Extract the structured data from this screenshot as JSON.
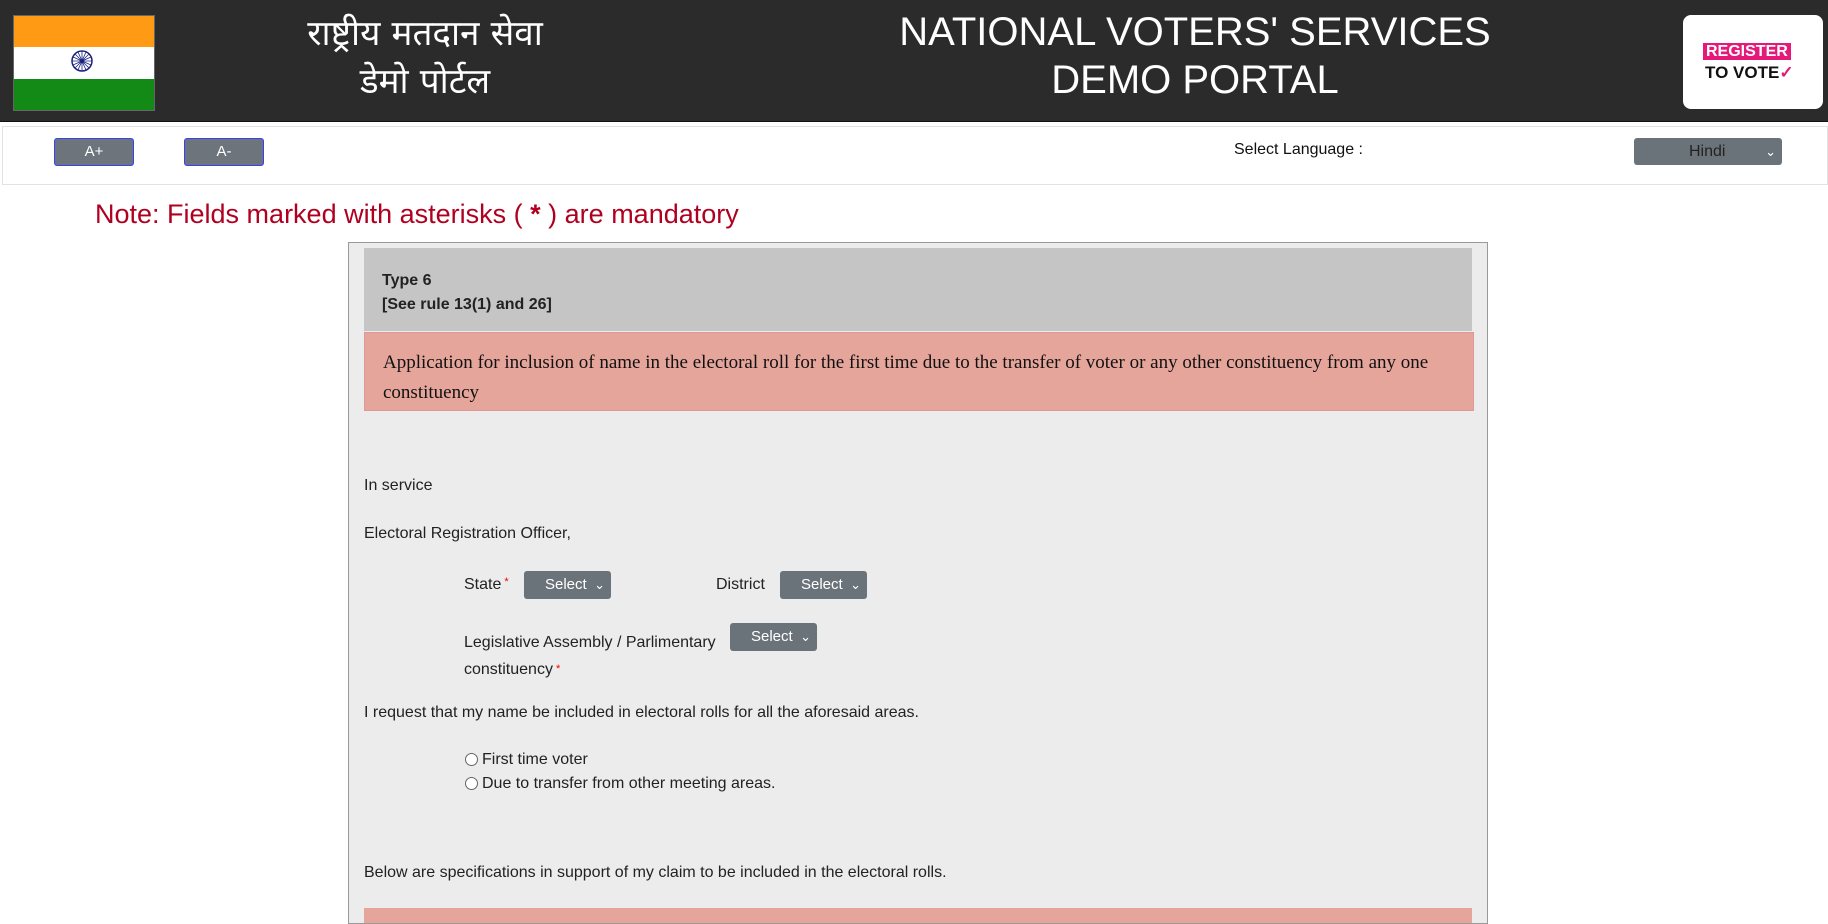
{
  "header": {
    "title_hindi_line1": "राष्ट्रीय मतदान सेवा",
    "title_hindi_line2": "डेमो पोर्टल",
    "title_english_line1": "NATIONAL VOTERS' SERVICES",
    "title_english_line2": "DEMO  PORTAL",
    "logo_line1": "REGISTER",
    "logo_line2": "TO VOTE",
    "logo_check": "✓"
  },
  "toolbar": {
    "font_increase_label": "A+",
    "font_decrease_label": "A-",
    "language_label": "Select Language :",
    "language_selected": "Hindi"
  },
  "note": {
    "prefix": "Note: Fields marked with asterisks (",
    "asterisk": "*",
    "suffix": ") are mandatory"
  },
  "form": {
    "type_line1": "Type 6",
    "type_line2": "[See rule 13(1) and 26]",
    "application_title": "Application for inclusion of name in the electoral roll for the first time due to the transfer of voter or any other constituency from any one constituency",
    "in_service": "In service",
    "officer": "Electoral Registration Officer,",
    "state_label": "State",
    "state_select": "Select",
    "district_label": "District",
    "district_select": "Select",
    "constituency_label_line1": "Legislative Assembly / Parlimentary",
    "constituency_label_line2": "constituency",
    "constituency_select": "Select",
    "request_text": "I request that my name be included in electoral rolls for all the aforesaid areas.",
    "radio_options": [
      "First time voter",
      "Due to transfer from other meeting areas."
    ],
    "specs_text": "Below are specifications in support of my claim to be included in the electoral rolls.",
    "required_marker": "*"
  },
  "colors": {
    "header_bg": "#2b2b2b",
    "note_red": "#b00020",
    "application_bg": "#e5a59b",
    "type_bg": "#c5c5c5",
    "select_bg": "#6b737a"
  }
}
